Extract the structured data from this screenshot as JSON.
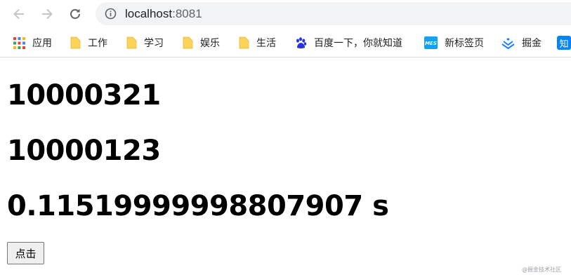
{
  "browser": {
    "url_host": "localhost",
    "url_port": ":8081"
  },
  "bookmarks": [
    {
      "label": "应用",
      "icon": "apps-grid-icon"
    },
    {
      "label": "工作",
      "icon": "folder-icon"
    },
    {
      "label": "学习",
      "icon": "folder-icon"
    },
    {
      "label": "娱乐",
      "icon": "folder-icon"
    },
    {
      "label": "生活",
      "icon": "folder-icon"
    },
    {
      "label": "百度一下，你就知道",
      "icon": "baidu-paw-icon"
    },
    {
      "label": "新标签页",
      "icon": "mes-icon"
    },
    {
      "label": "掘金",
      "icon": "juejin-icon"
    },
    {
      "label": "知",
      "icon": "zhihu-icon"
    }
  ],
  "page": {
    "value_1": "10000321",
    "value_2": "10000123",
    "elapsed": "0.11519999998807907 s",
    "button_label": "点击",
    "watermark": "@掘金技术社区"
  },
  "colors": {
    "folder": "#fbd35a",
    "baidu": "#2932e1",
    "mes": "#1aa0e6",
    "juejin": "#1e80ff",
    "zhihu": "#0084ff"
  }
}
